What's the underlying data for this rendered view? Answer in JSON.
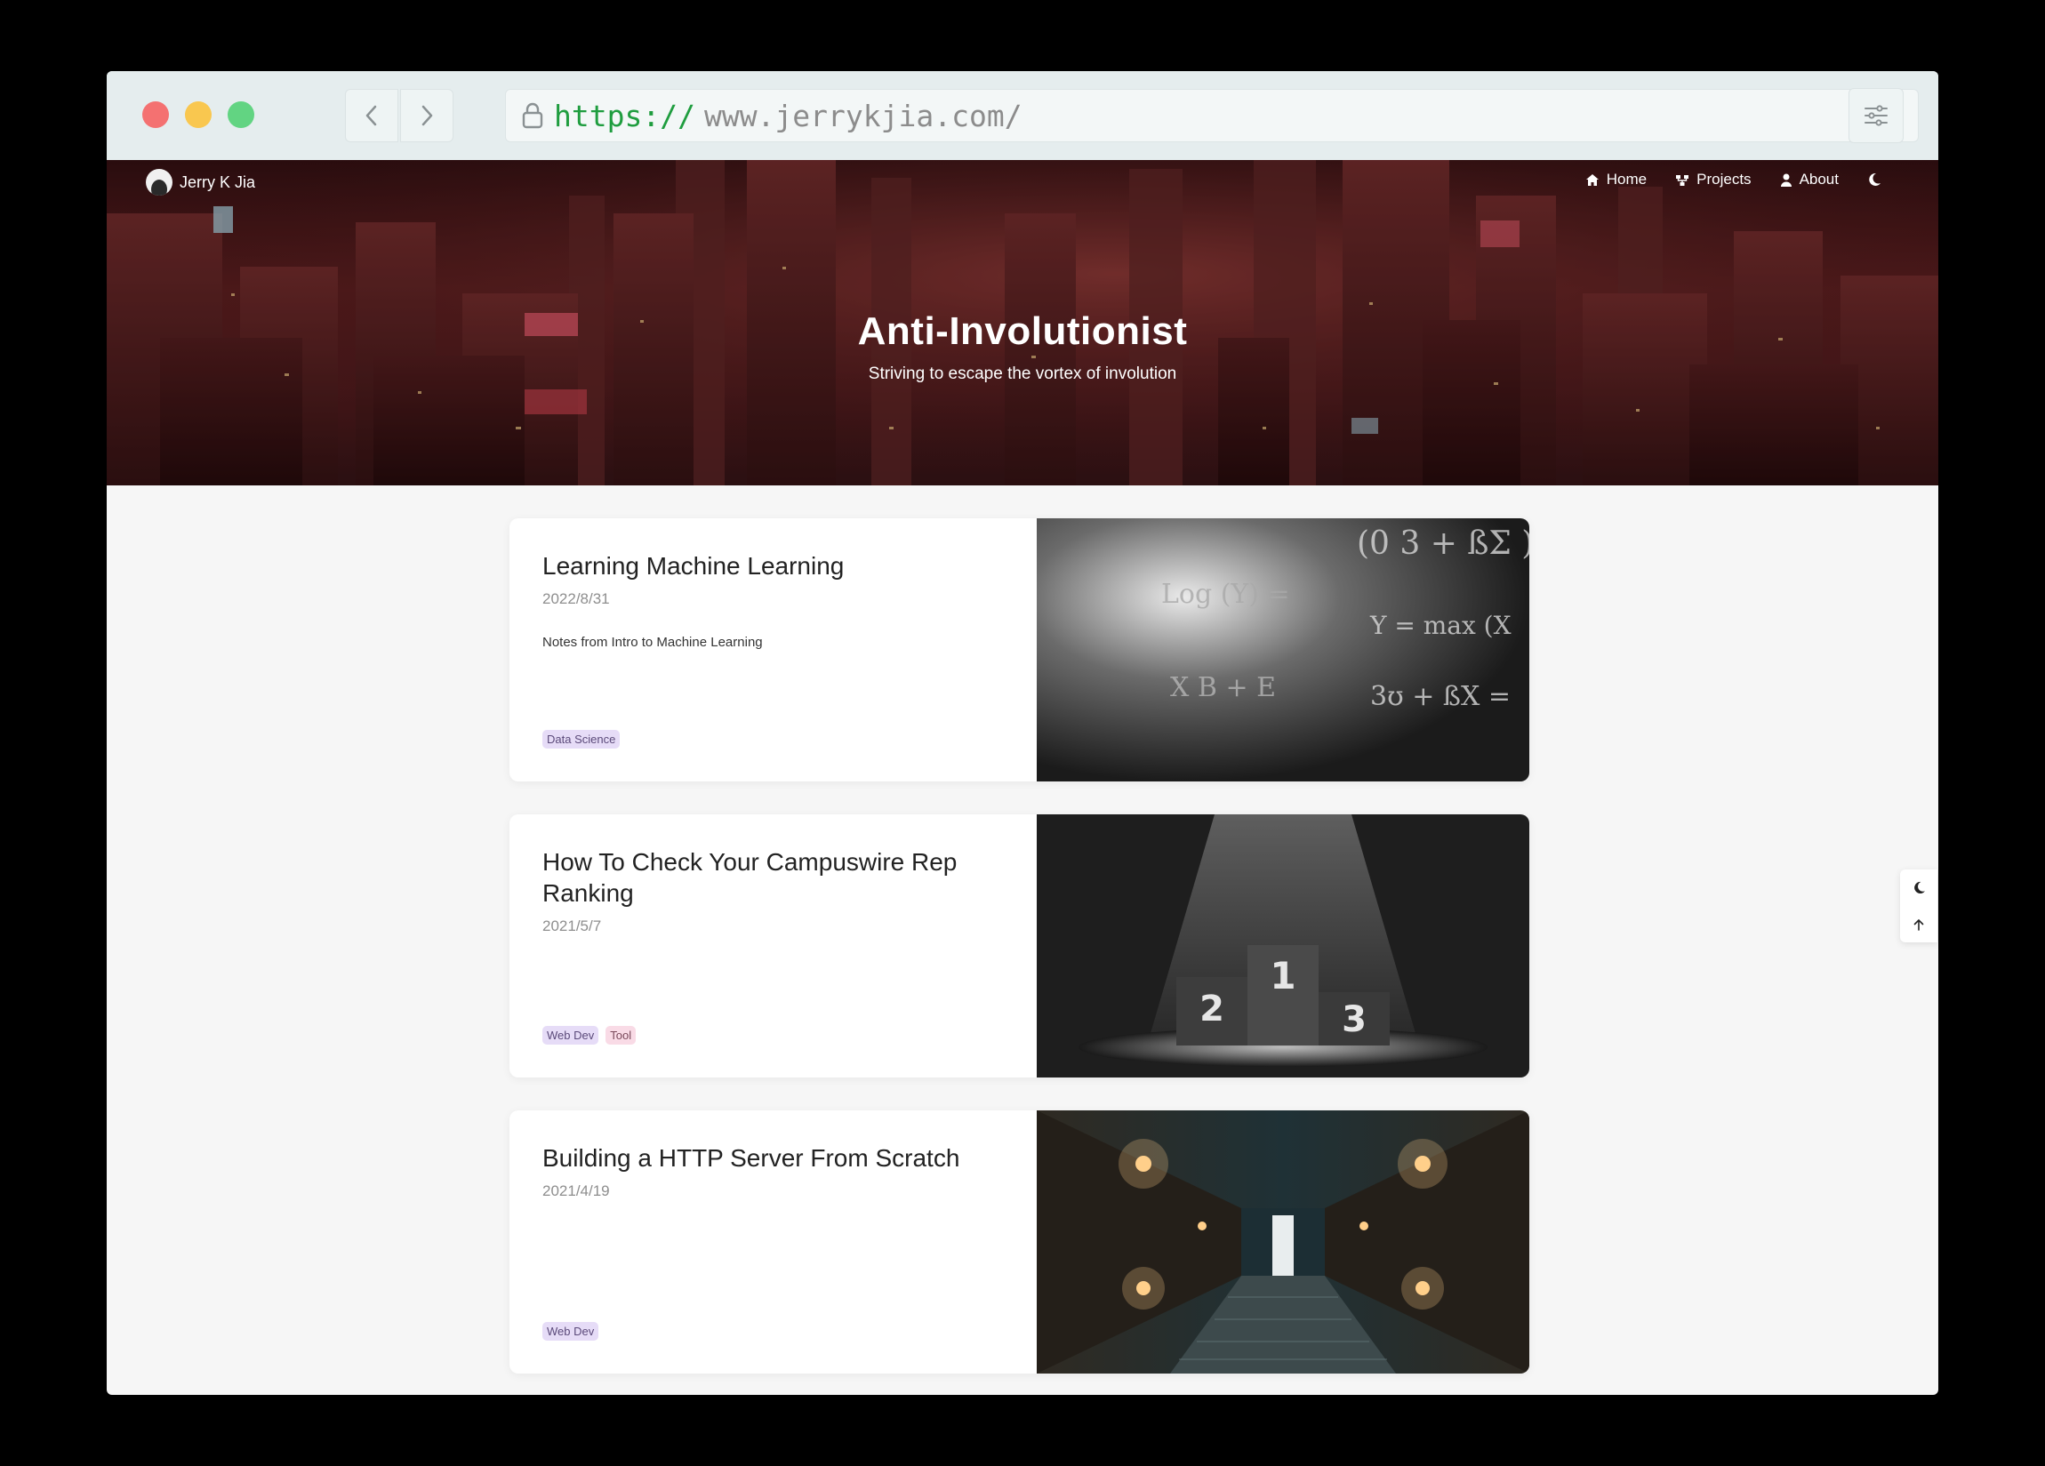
{
  "browser": {
    "url_scheme": "https://",
    "url_host": "www.jerrykjia.com/"
  },
  "site": {
    "brand": "Jerry K Jia",
    "nav": [
      {
        "label": "Home",
        "icon": "home-icon"
      },
      {
        "label": "Projects",
        "icon": "projects-icon"
      },
      {
        "label": "About",
        "icon": "user-icon"
      }
    ],
    "hero_title": "Anti-Involutionist",
    "hero_subtitle": "Striving to escape the vortex of involution"
  },
  "posts": [
    {
      "title": "Learning Machine Learning",
      "date": "2022/8/31",
      "description": "Notes from Intro to Machine Learning",
      "tags": [
        {
          "label": "Data Science",
          "color": "#e6dcf7",
          "text": "#5b4a7a"
        }
      ]
    },
    {
      "title": "How To Check Your Campuswire Rep Ranking",
      "date": "2021/5/7",
      "description": "",
      "tags": [
        {
          "label": "Web Dev",
          "color": "#e6dcf7",
          "text": "#5b4a7a"
        },
        {
          "label": "Tool",
          "color": "#f9dbe6",
          "text": "#7a4a5b"
        }
      ]
    },
    {
      "title": "Building a HTTP Server From Scratch",
      "date": "2021/4/19",
      "description": "",
      "tags": [
        {
          "label": "Web Dev",
          "color": "#e6dcf7",
          "text": "#5b4a7a"
        }
      ]
    }
  ],
  "thumbnail_1_text": [
    "(0 3 + ßΣ )",
    "Log (Y) =",
    "Y = max (X",
    "X  B  + E",
    "3ʊ + ßX ="
  ],
  "thumbnail_2_text": [
    "1",
    "2",
    "3"
  ]
}
